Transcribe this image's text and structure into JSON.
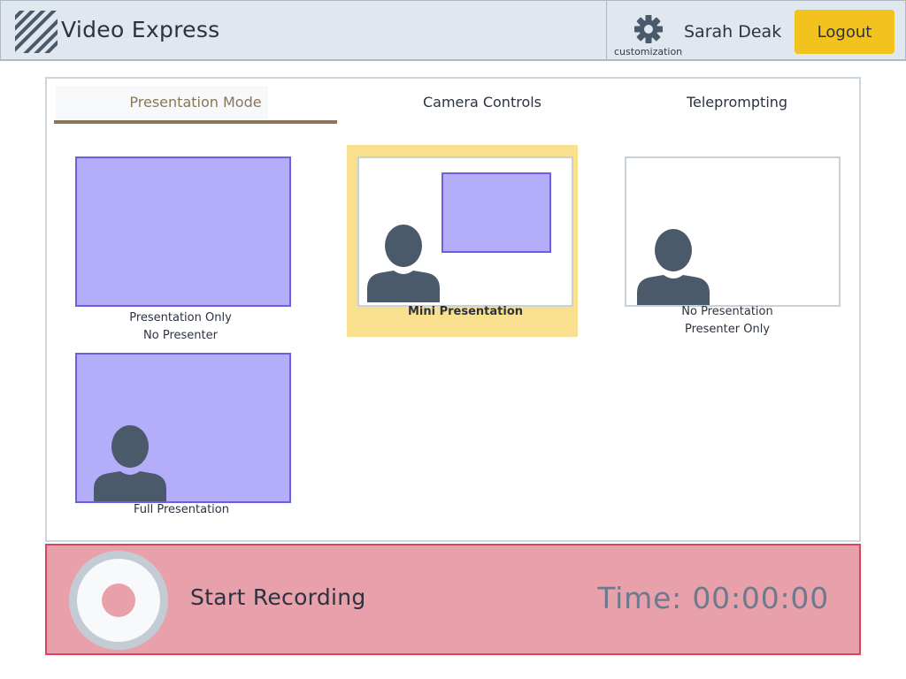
{
  "header": {
    "app_title": "Video Express",
    "settings_label": "customization",
    "user_name": "Sarah Deak",
    "logout_label": "Logout"
  },
  "tabs": [
    {
      "label": "Presentation Mode",
      "active": true
    },
    {
      "label": "Camera Controls",
      "active": false
    },
    {
      "label": "Teleprompting",
      "active": false
    }
  ],
  "modes": {
    "presentation_only": {
      "line1": "Presentation Only",
      "line2": "No Presenter"
    },
    "mini_presentation": {
      "line1": "Mini Presentation",
      "selected": true
    },
    "presenter_only": {
      "line1": "No Presentation",
      "line2": "Presenter Only"
    },
    "full_presentation": {
      "line1": "Full Presentation"
    }
  },
  "recording": {
    "label": "Start Recording",
    "time": "Time: 00:00:00"
  },
  "colors": {
    "accent_yellow": "#f4c21f",
    "selected_bg": "#f9e08f",
    "slide": "#b3adfa",
    "slide_border": "#6e5ee0",
    "record_bar": "#e8a0aa",
    "tab_active": "#8a7558"
  },
  "icons": {
    "logo": "striped-logo-icon",
    "settings": "gear-icon",
    "presenter": "person-icon",
    "record": "record-dot-icon"
  }
}
